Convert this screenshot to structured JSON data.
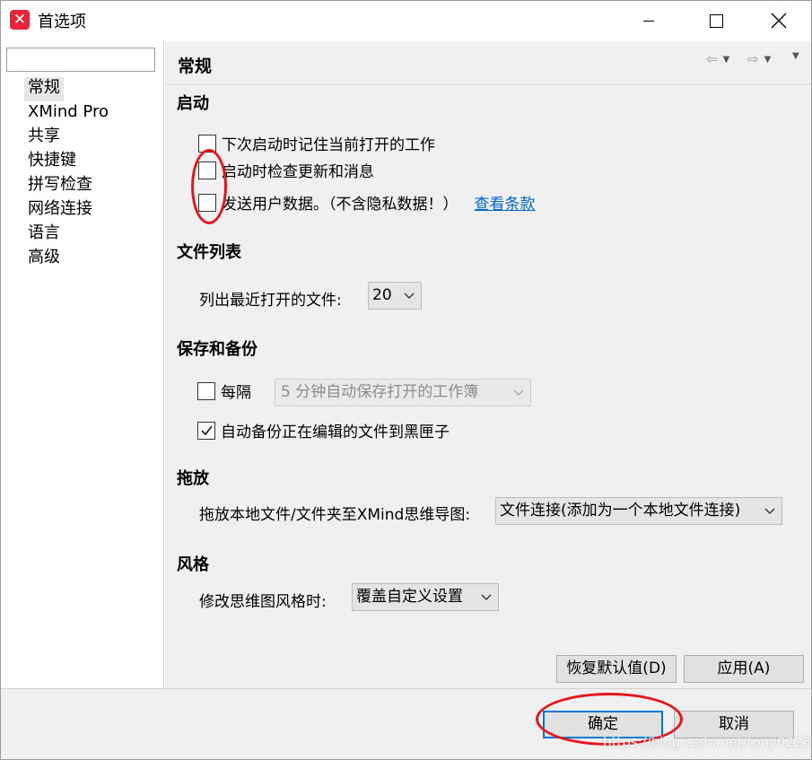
{
  "window": {
    "title": "首选项",
    "logo_glyph": "✕"
  },
  "sidebar": {
    "filter_value": "",
    "items": [
      {
        "label": "常规",
        "selected": true
      },
      {
        "label": "XMind Pro"
      },
      {
        "label": "共享"
      },
      {
        "label": "快捷键"
      },
      {
        "label": "拼写检查"
      },
      {
        "label": "网络连接"
      },
      {
        "label": "语言"
      },
      {
        "label": "高级"
      }
    ]
  },
  "page": {
    "title": "常规"
  },
  "startup": {
    "title": "启动",
    "remember_label": "下次启动时记住当前打开的工作",
    "remember_checked": false,
    "check_updates_label": "启动时检查更新和消息",
    "check_updates_checked": false,
    "send_data_label": "发送用户数据。（不含隐私数据！）",
    "send_data_checked": false,
    "terms_link": "查看条款"
  },
  "file_list": {
    "title": "文件列表",
    "recent_label": "列出最近打开的文件:",
    "recent_value": "20"
  },
  "save_backup": {
    "title": "保存和备份",
    "every_label": "每隔",
    "every_checked": false,
    "autosave_value": "5  分钟自动保存打开的工作簿",
    "backup_label": "自动备份正在编辑的文件到黑匣子",
    "backup_checked": true
  },
  "drag_drop": {
    "title": "拖放",
    "label": "拖放本地文件/文件夹至XMind思维导图:",
    "value": "文件连接(添加为一个本地文件连接)"
  },
  "style": {
    "title": "风格",
    "label": "修改思维图风格时:",
    "value": "覆盖自定义设置"
  },
  "buttons": {
    "restore_defaults": "恢复默认值(D)",
    "apply": "应用(A)",
    "ok": "确定",
    "cancel": "取消"
  },
  "watermark": "https://blog.csdn.net/tony0225",
  "colors": {
    "annotation": "#e8141c",
    "link": "#0066cc",
    "default_button_border": "#0078d7"
  }
}
